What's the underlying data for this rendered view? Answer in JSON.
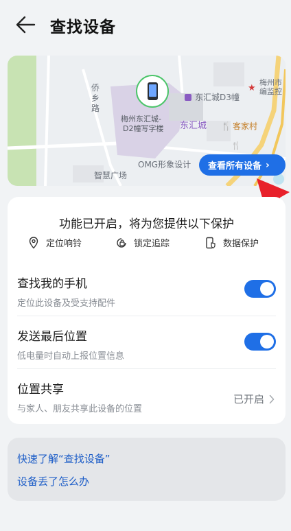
{
  "header": {
    "title": "查找设备",
    "back_icon": "arrow-left-icon"
  },
  "map": {
    "labels": {
      "road_1": "侨",
      "road_2": "乡",
      "road_3": "路",
      "device_place_1": "梅州东汇城-",
      "device_place_2": "D2幢写字楼",
      "mall_d3": "东汇城D3幢",
      "city_1": "梅州市",
      "city_2": "编监控",
      "mall_name": "东汇城",
      "restaurant": "客家村",
      "omg": "OMG形象设计",
      "plaza": "智慧广场"
    },
    "view_all_label": "查看所有设备",
    "colors": {
      "park": "#c8e3b3",
      "building": "#d9d2e6",
      "road_yellow": "#f5d37a",
      "button": "#1f6fe6"
    }
  },
  "protection": {
    "title": "功能已开启，将为您提供以下保护",
    "features": [
      {
        "icon": "location-pin-icon",
        "label": "定位响铃"
      },
      {
        "icon": "lock-track-icon",
        "label": "锁定追踪"
      },
      {
        "icon": "phone-shield-icon",
        "label": "数据保护"
      }
    ],
    "rows": [
      {
        "title": "查找我的手机",
        "subtitle": "定位此设备及受支持配件",
        "toggle_on": true
      },
      {
        "title": "发送最后位置",
        "subtitle": "低电量时自动上报位置信息",
        "toggle_on": true
      },
      {
        "title": "位置共享",
        "subtitle": "与家人、朋友共享此设备的位置",
        "status": "已开启"
      }
    ]
  },
  "help": {
    "links": [
      "快速了解“查找设备”",
      "设备丢了怎么办"
    ]
  },
  "accent_color": "#1f6fe6"
}
